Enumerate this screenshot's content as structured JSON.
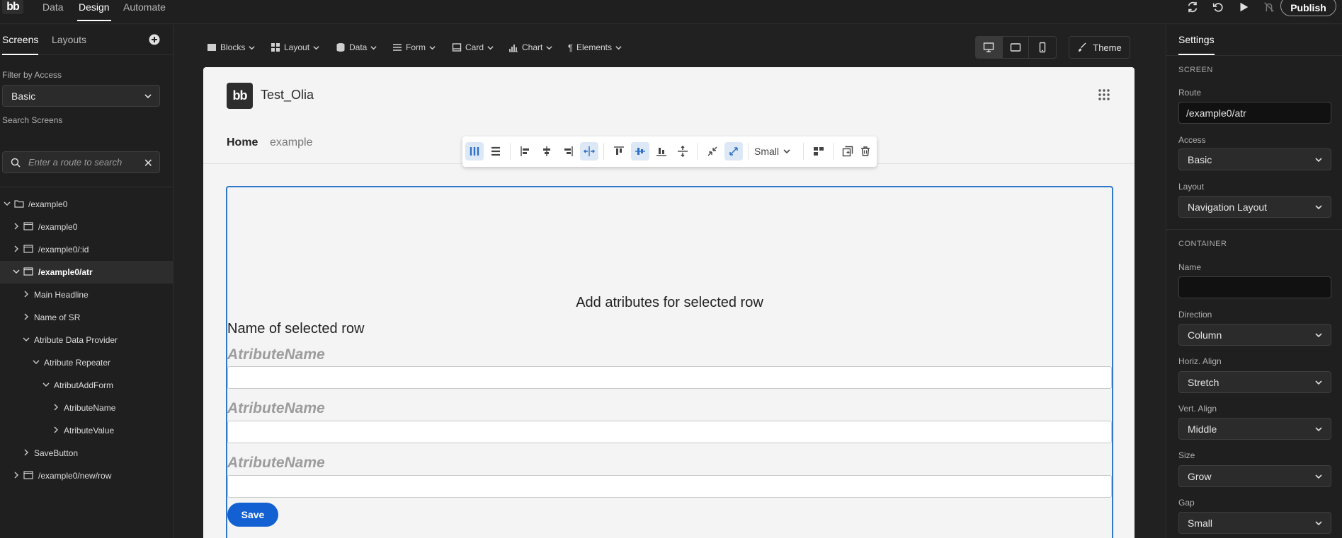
{
  "topbar": {
    "logo": "bb",
    "tabs": [
      "Data",
      "Design",
      "Automate"
    ],
    "publish_label": "Publish"
  },
  "left_panel": {
    "tabs": [
      "Screens",
      "Layouts"
    ],
    "filter_label": "Filter by Access",
    "filter_value": "Basic",
    "search_label": "Search Screens",
    "search_placeholder": "Enter a route to search",
    "tree": [
      {
        "label": "/example0"
      },
      {
        "label": "/example0"
      },
      {
        "label": "/example0/:id"
      },
      {
        "label": "/example0/atr"
      },
      {
        "label": "Main Headline"
      },
      {
        "label": "Name of SR"
      },
      {
        "label": "Atribute Data Provider"
      },
      {
        "label": "Atribute Repeater"
      },
      {
        "label": "AtributAddForm"
      },
      {
        "label": "AtributeName"
      },
      {
        "label": "AtributeValue"
      },
      {
        "label": "SaveButton"
      },
      {
        "label": "/example0/new/row"
      }
    ]
  },
  "toolbar": {
    "items": [
      "Blocks",
      "Layout",
      "Data",
      "Form",
      "Card",
      "Chart",
      "Elements"
    ],
    "theme_label": "Theme"
  },
  "canvas": {
    "app_logo": "bb",
    "app_title": "Test_Olia",
    "nav": [
      "Home",
      "example"
    ],
    "size_label": "Small",
    "heading": "Add atributes for selected row",
    "row_name": "Name of selected row",
    "field_labels": [
      "AtributeName",
      "AtributeName",
      "AtributeName"
    ],
    "save_label": "Save"
  },
  "settings": {
    "tab": "Settings",
    "screen_section": "SCREEN",
    "route_label": "Route",
    "route_value": "/example0/atr",
    "access_label": "Access",
    "access_value": "Basic",
    "layout_label": "Layout",
    "layout_value": "Navigation Layout",
    "container_section": "CONTAINER",
    "name_label": "Name",
    "name_value": "",
    "direction_label": "Direction",
    "direction_value": "Column",
    "halign_label": "Horiz. Align",
    "halign_value": "Stretch",
    "valign_label": "Vert. Align",
    "valign_value": "Middle",
    "size_label": "Size",
    "size_value": "Grow",
    "gap_label": "Gap",
    "gap_value": "Small"
  },
  "colors": {
    "selection_border": "#2f78c9",
    "save_button": "#1260d1",
    "active_tool": "#dde8f6"
  }
}
